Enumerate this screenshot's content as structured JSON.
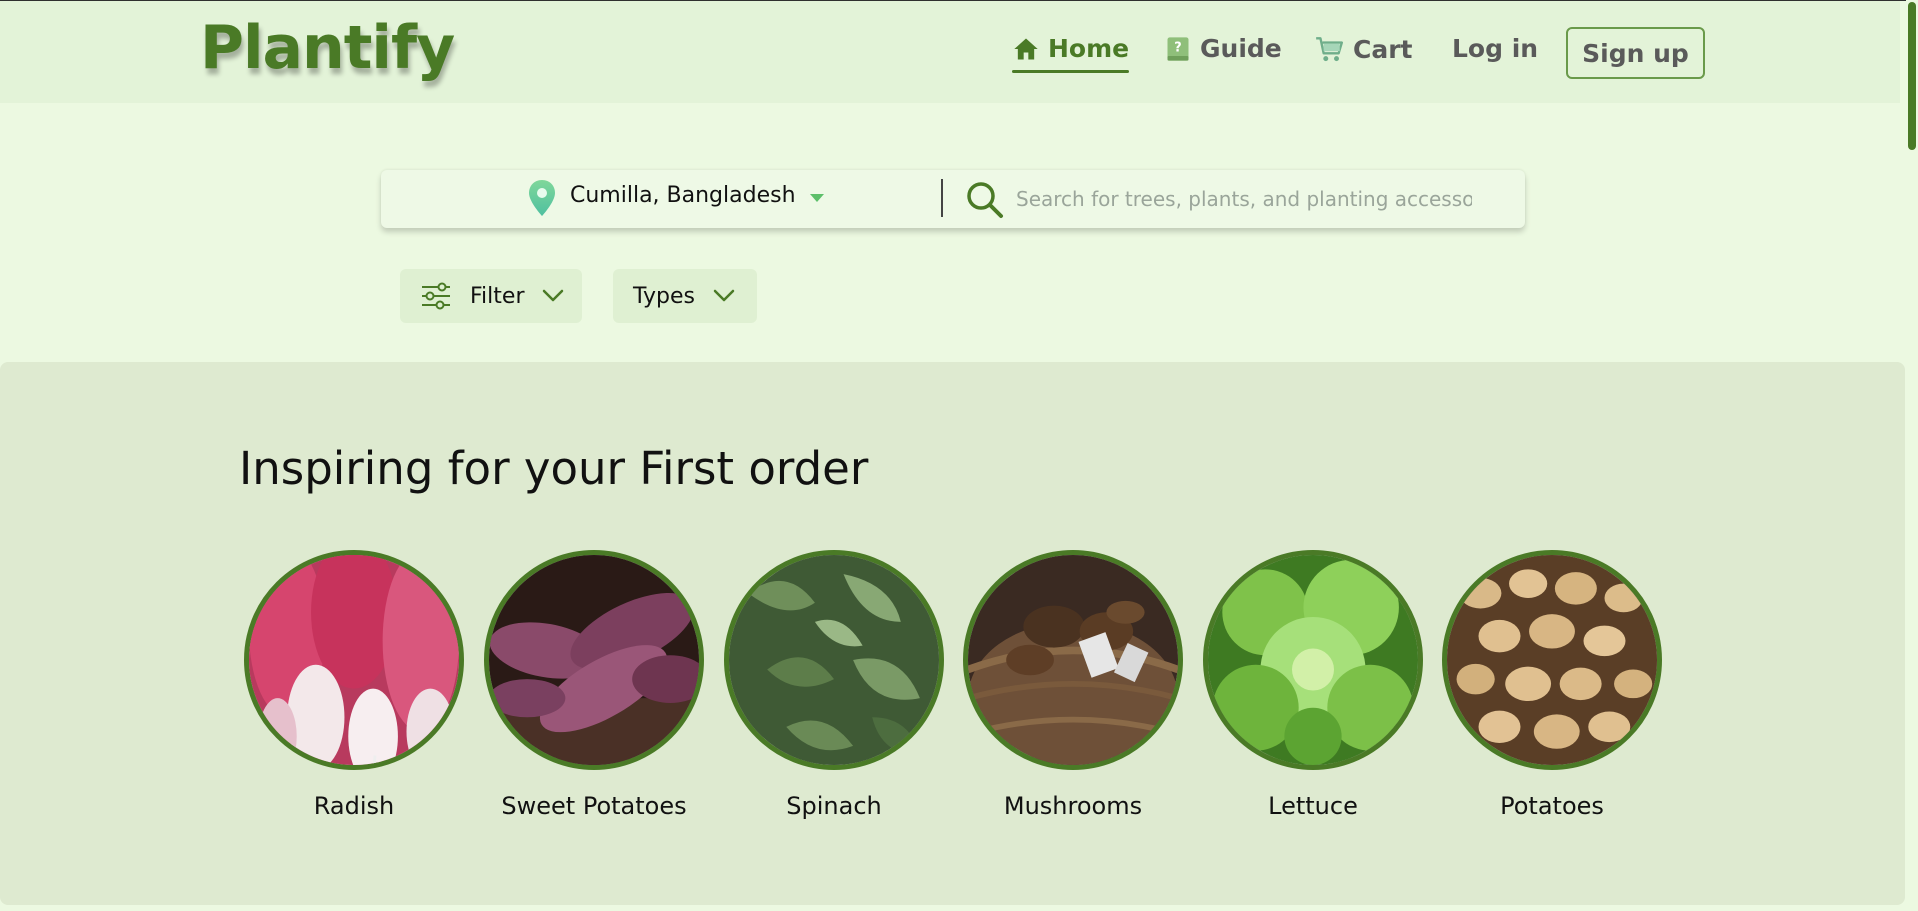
{
  "brand": {
    "name": "Plantify",
    "accent": "#4a7a26"
  },
  "nav": {
    "items": [
      {
        "label": "Home",
        "icon": "home-icon",
        "active": true
      },
      {
        "label": "Guide",
        "icon": "book-icon",
        "active": false
      },
      {
        "label": "Cart",
        "icon": "cart-icon",
        "active": false
      },
      {
        "label": "Log in",
        "icon": null,
        "active": false
      }
    ],
    "signup_label": "Sign up"
  },
  "search": {
    "location": "Cumilla, Bangladesh",
    "location_icon": "map-pin-icon",
    "placeholder": "Search for trees, plants, and planting accessories",
    "search_icon": "search-icon"
  },
  "filters": {
    "filter_label": "Filter",
    "types_label": "Types"
  },
  "section": {
    "title": "Inspiring for your First order",
    "categories": [
      {
        "label": "Radish"
      },
      {
        "label": "Sweet Potatoes"
      },
      {
        "label": "Spinach"
      },
      {
        "label": "Mushrooms"
      },
      {
        "label": "Lettuce"
      },
      {
        "label": "Potatoes"
      }
    ]
  }
}
